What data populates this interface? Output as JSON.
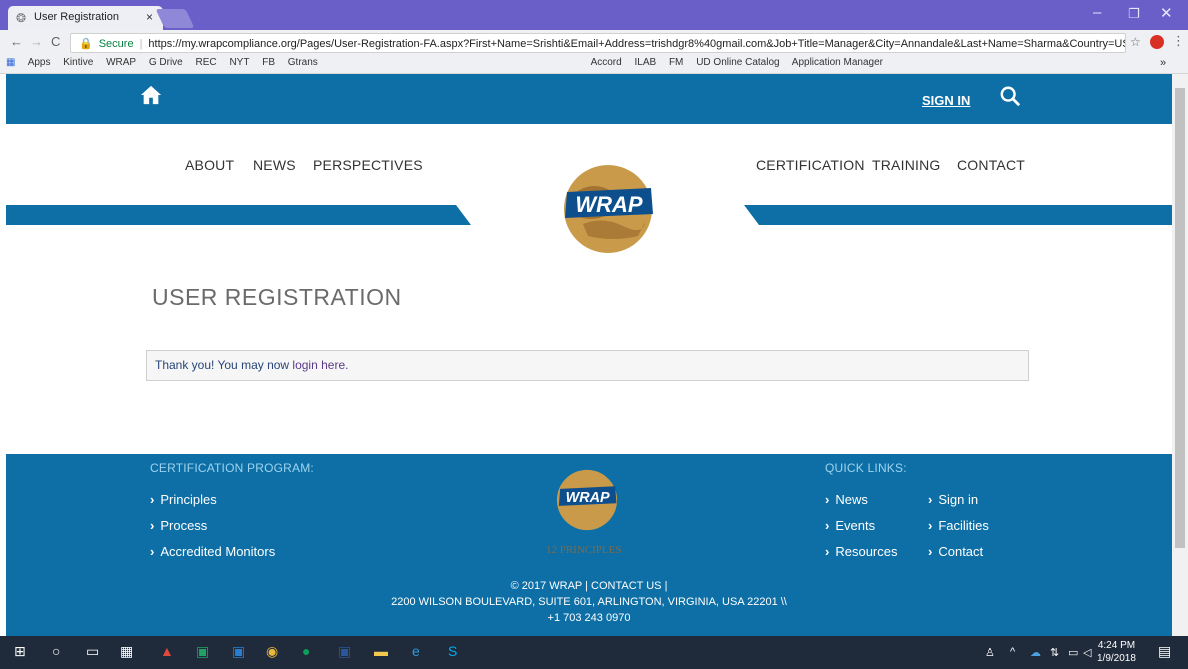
{
  "browser": {
    "tab_title": "User Registration",
    "tab_close": "×",
    "secure_label": "Secure",
    "url": "https://my.wrapcompliance.org/Pages/User-Registration-FA.aspx?First+Name=Srishti&Email+Address=trishdgr8%40gmail.com&Job+Title=Manager&City=Annandale&Last+Name=Sharma&Country=USA&Count...",
    "bookmarks": [
      "Apps",
      "Kintive",
      "WRAP",
      "G Drive",
      "REC",
      "NYT",
      "FB",
      "Gtrans",
      "Accord",
      "ILAB",
      "FM",
      "UD Online Catalog",
      "Application Manager"
    ],
    "more": "»"
  },
  "header": {
    "signin_label": "SIGN IN"
  },
  "nav": {
    "left": [
      "ABOUT",
      "NEWS",
      "PERSPECTIVES"
    ],
    "right": [
      "CERTIFICATION",
      "TRAINING",
      "CONTACT"
    ]
  },
  "main": {
    "title": "USER REGISTRATION",
    "message_prefix": "Thank you!  You may now ",
    "message_link": "login here."
  },
  "footer": {
    "cert_heading": "CERTIFICATION PROGRAM:",
    "cert_links": [
      "Principles",
      "Process",
      "Accredited Monitors"
    ],
    "principles_label": "12 PRINCIPLES",
    "quick_heading": "QUICK LINKS:",
    "quick_col1": [
      "News",
      "Events",
      "Resources"
    ],
    "quick_col2": [
      "Sign in",
      "Facilities",
      "Contact"
    ],
    "copyright": "© 2017 WRAP | CONTACT US |",
    "address": "2200 WILSON BOULEVARD, SUITE 601, ARLINGTON, VIRGINIA, USA 22201 \\\\",
    "phone": "+1 703 243 0970"
  },
  "taskbar": {
    "time": "4:24 PM",
    "date": "1/9/2018"
  },
  "colors": {
    "brand_blue": "#0d6fa6",
    "tab_bar": "#6a5fc8"
  }
}
